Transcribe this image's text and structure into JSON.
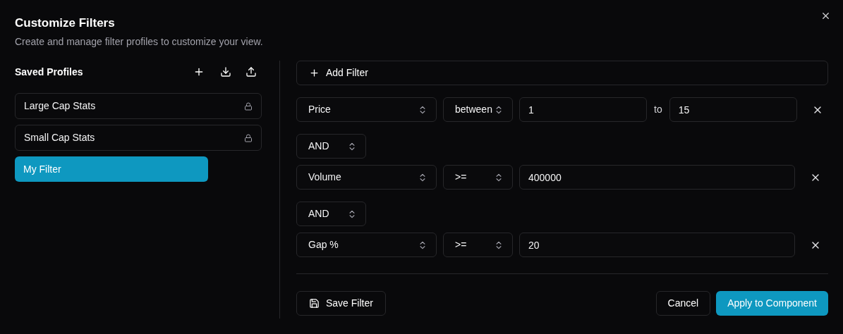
{
  "dialog": {
    "title": "Customize Filters",
    "description": "Create and manage filter profiles to customize your view."
  },
  "profiles": {
    "heading": "Saved Profiles",
    "items": [
      {
        "name": "Large Cap Stats",
        "locked": true,
        "selected": false
      },
      {
        "name": "Small Cap Stats",
        "locked": true,
        "selected": false
      },
      {
        "name": "My Filter",
        "locked": false,
        "selected": true
      }
    ]
  },
  "add_filter_button": "Add Filter",
  "filters": [
    {
      "kind": "range",
      "field": "Price",
      "operator": "between",
      "value": "1",
      "range_word": "to",
      "value_to": "15"
    },
    {
      "kind": "single",
      "connector": "AND",
      "field": "Volume",
      "operator": ">=",
      "value": "400000"
    },
    {
      "kind": "single",
      "connector": "AND",
      "field": "Gap %",
      "operator": ">=",
      "value": "20"
    }
  ],
  "buttons": {
    "save": "Save Filter",
    "cancel": "Cancel",
    "apply": "Apply to Component"
  }
}
